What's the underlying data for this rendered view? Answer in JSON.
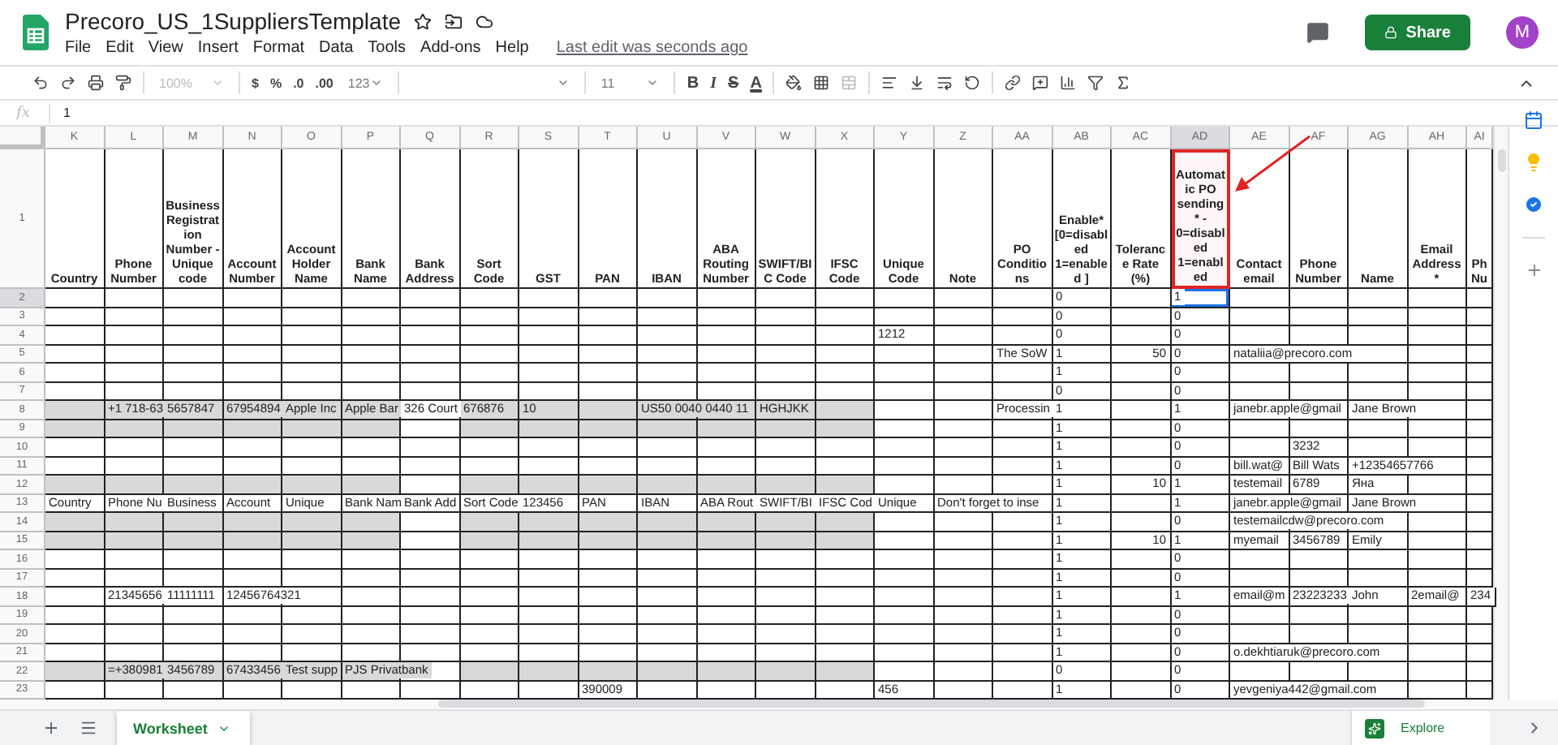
{
  "document": {
    "title": "Precoro_US_1SuppliersTemplate",
    "menu": [
      "File",
      "Edit",
      "View",
      "Insert",
      "Format",
      "Data",
      "Tools",
      "Add-ons",
      "Help"
    ],
    "last_edit": "Last edit was seconds ago"
  },
  "account": {
    "share_label": "Share",
    "avatar_initial": "M"
  },
  "toolbar": {
    "zoom": "100%",
    "currency": "$",
    "percent": "%",
    "decimal_less": ".0",
    "decimal_more": ".00",
    "number_format": "123",
    "font_size": "11",
    "bold": "B",
    "italic": "I",
    "strike": "S",
    "text_color": "A"
  },
  "formula_bar": {
    "fx_label": "fx",
    "value": "1"
  },
  "columns": [
    {
      "letter": "K",
      "shade_band": true,
      "selected": false,
      "highlighted": false,
      "numeric": false
    },
    {
      "letter": "L",
      "shade_band": true,
      "selected": false,
      "highlighted": false,
      "numeric": false
    },
    {
      "letter": "M",
      "shade_band": true,
      "selected": false,
      "highlighted": false,
      "numeric": false
    },
    {
      "letter": "N",
      "shade_band": true,
      "selected": false,
      "highlighted": false,
      "numeric": false
    },
    {
      "letter": "O",
      "shade_band": true,
      "selected": false,
      "highlighted": false,
      "numeric": false
    },
    {
      "letter": "P",
      "shade_band": true,
      "selected": false,
      "highlighted": false,
      "numeric": false
    },
    {
      "letter": "Q",
      "shade_band": false,
      "selected": false,
      "highlighted": false,
      "numeric": false
    },
    {
      "letter": "R",
      "shade_band": true,
      "selected": false,
      "highlighted": false,
      "numeric": false
    },
    {
      "letter": "S",
      "shade_band": true,
      "selected": false,
      "highlighted": false,
      "numeric": false
    },
    {
      "letter": "T",
      "shade_band": true,
      "selected": false,
      "highlighted": false,
      "numeric": false
    },
    {
      "letter": "U",
      "shade_band": true,
      "selected": false,
      "highlighted": false,
      "numeric": false
    },
    {
      "letter": "V",
      "shade_band": true,
      "selected": false,
      "highlighted": false,
      "numeric": false
    },
    {
      "letter": "W",
      "shade_band": true,
      "selected": false,
      "highlighted": false,
      "numeric": false
    },
    {
      "letter": "X",
      "shade_band": true,
      "selected": false,
      "highlighted": false,
      "numeric": false
    },
    {
      "letter": "Y",
      "shade_band": false,
      "selected": false,
      "highlighted": false,
      "numeric": false
    },
    {
      "letter": "Z",
      "shade_band": false,
      "selected": false,
      "highlighted": false,
      "numeric": false
    },
    {
      "letter": "AA",
      "shade_band": false,
      "selected": false,
      "highlighted": false,
      "numeric": false
    },
    {
      "letter": "AB",
      "shade_band": false,
      "selected": false,
      "highlighted": false,
      "numeric": false
    },
    {
      "letter": "AC",
      "shade_band": false,
      "selected": false,
      "highlighted": false,
      "numeric": true
    },
    {
      "letter": "AD",
      "shade_band": false,
      "selected": true,
      "highlighted": true,
      "numeric": false
    },
    {
      "letter": "AE",
      "shade_band": false,
      "selected": false,
      "highlighted": false,
      "numeric": false
    },
    {
      "letter": "AF",
      "shade_band": false,
      "selected": false,
      "highlighted": false,
      "numeric": false
    },
    {
      "letter": "AG",
      "shade_band": false,
      "selected": false,
      "highlighted": false,
      "numeric": false
    },
    {
      "letter": "AH",
      "shade_band": false,
      "selected": false,
      "highlighted": false,
      "numeric": false
    },
    {
      "letter": "AI",
      "shade_band": false,
      "selected": false,
      "highlighted": false,
      "numeric": false
    }
  ],
  "header_row": {
    "number": "1",
    "cells": [
      "Country",
      "Phone Number",
      "Business Registration Number - Unique code",
      "Account Number",
      "Account Holder Name",
      "Bank Name",
      "Bank Address",
      "Sort Code",
      "GST",
      "PAN",
      "IBAN",
      "ABA Routing Number",
      "SWIFT/BIC Code",
      "IFSC Code",
      "Unique Code",
      "Note",
      "PO Conditions",
      "Enable* [0=disabled 1=enabled ]",
      "Tolerance Rate (%)",
      "Automatic PO sending* - 0=disabled 1=enabled",
      "Contact email",
      "Phone Number",
      "Name",
      "Email Address *",
      "Ph Nu"
    ]
  },
  "rows": [
    {
      "number": "2",
      "shaded": false,
      "selected": true,
      "cells": [
        null,
        null,
        null,
        null,
        null,
        null,
        null,
        null,
        null,
        null,
        null,
        null,
        null,
        null,
        null,
        null,
        null,
        "0",
        null,
        "1",
        null,
        null,
        null,
        null,
        null
      ]
    },
    {
      "number": "3",
      "shaded": false,
      "selected": false,
      "cells": [
        null,
        null,
        null,
        null,
        null,
        null,
        null,
        null,
        null,
        null,
        null,
        null,
        null,
        null,
        null,
        null,
        null,
        "0",
        null,
        "0",
        null,
        null,
        null,
        null,
        null
      ]
    },
    {
      "number": "4",
      "shaded": false,
      "selected": false,
      "cells": [
        null,
        null,
        null,
        null,
        null,
        null,
        null,
        null,
        null,
        null,
        null,
        null,
        null,
        null,
        "1212",
        null,
        null,
        "0",
        null,
        "0",
        null,
        null,
        null,
        null,
        null
      ]
    },
    {
      "number": "5",
      "shaded": false,
      "selected": false,
      "cells": [
        null,
        null,
        null,
        null,
        null,
        null,
        null,
        null,
        null,
        null,
        null,
        null,
        null,
        null,
        null,
        null,
        "The SoW",
        "1",
        "50",
        "0",
        "nataliia@precoro.com",
        null,
        null,
        null,
        null
      ]
    },
    {
      "number": "6",
      "shaded": false,
      "selected": false,
      "cells": [
        null,
        null,
        null,
        null,
        null,
        null,
        null,
        null,
        null,
        null,
        null,
        null,
        null,
        null,
        null,
        null,
        null,
        "1",
        null,
        "0",
        null,
        null,
        null,
        null,
        null
      ]
    },
    {
      "number": "7",
      "shaded": false,
      "selected": false,
      "cells": [
        null,
        null,
        null,
        null,
        null,
        null,
        null,
        null,
        null,
        null,
        null,
        null,
        null,
        null,
        null,
        null,
        null,
        "0",
        null,
        "0",
        null,
        null,
        null,
        null,
        null
      ]
    },
    {
      "number": "8",
      "shaded": true,
      "selected": false,
      "cells": [
        null,
        "+1 718-63",
        "5657847",
        "67954894",
        "Apple Inc",
        "Apple Bar",
        "326 Court",
        "676876",
        "10",
        null,
        "US50 0040 0440 11",
        null,
        "HGHJKK",
        null,
        null,
        null,
        "Processin",
        "1",
        null,
        "1",
        "janebr.apple@gmail",
        null,
        "Jane Brown",
        null,
        null
      ]
    },
    {
      "number": "9",
      "shaded": true,
      "selected": false,
      "cells": [
        null,
        null,
        null,
        null,
        null,
        null,
        null,
        null,
        null,
        null,
        null,
        null,
        null,
        null,
        null,
        null,
        null,
        "1",
        null,
        "0",
        null,
        null,
        null,
        null,
        null
      ]
    },
    {
      "number": "10",
      "shaded": false,
      "selected": false,
      "cells": [
        null,
        null,
        null,
        null,
        null,
        null,
        null,
        null,
        null,
        null,
        null,
        null,
        null,
        null,
        null,
        null,
        null,
        "1",
        null,
        "0",
        null,
        "3232",
        null,
        null,
        null
      ]
    },
    {
      "number": "11",
      "shaded": false,
      "selected": false,
      "cells": [
        null,
        null,
        null,
        null,
        null,
        null,
        null,
        null,
        null,
        null,
        null,
        null,
        null,
        null,
        null,
        null,
        null,
        "1",
        null,
        "0",
        "bill.wat@",
        "Bill Wats",
        "+12354657766",
        null,
        null
      ]
    },
    {
      "number": "12",
      "shaded": true,
      "selected": false,
      "cells": [
        null,
        null,
        null,
        null,
        null,
        null,
        null,
        null,
        null,
        null,
        null,
        null,
        null,
        null,
        null,
        null,
        null,
        "1",
        "10",
        "1",
        "testemail",
        "6789",
        "Яна",
        null,
        null
      ]
    },
    {
      "number": "13",
      "shaded": false,
      "selected": false,
      "cells": [
        "Country",
        "Phone Nu",
        "Business",
        "Account",
        "Unique",
        "Bank Nam",
        "Bank Add",
        "Sort Code",
        "123456",
        "PAN",
        "IBAN",
        "ABA Rout",
        "SWIFT/BI",
        "IFSC Cod",
        "Unique",
        "Don't forget to inse",
        null,
        "1",
        null,
        "1",
        "janebr.apple@gmail",
        null,
        "Jane Brown",
        null,
        null
      ]
    },
    {
      "number": "14",
      "shaded": true,
      "selected": false,
      "cells": [
        null,
        null,
        null,
        null,
        null,
        null,
        null,
        null,
        null,
        null,
        null,
        null,
        null,
        null,
        null,
        null,
        null,
        "1",
        null,
        "0",
        "testemailcdw@precoro.com",
        null,
        null,
        null,
        null
      ]
    },
    {
      "number": "15",
      "shaded": true,
      "selected": false,
      "cells": [
        null,
        null,
        null,
        null,
        null,
        null,
        null,
        null,
        null,
        null,
        null,
        null,
        null,
        null,
        null,
        null,
        null,
        "1",
        "10",
        "1",
        "myemail",
        "3456789",
        "Emily",
        null,
        null
      ]
    },
    {
      "number": "16",
      "shaded": false,
      "selected": false,
      "cells": [
        null,
        null,
        null,
        null,
        null,
        null,
        null,
        null,
        null,
        null,
        null,
        null,
        null,
        null,
        null,
        null,
        null,
        "1",
        null,
        "0",
        null,
        null,
        null,
        null,
        null
      ]
    },
    {
      "number": "17",
      "shaded": false,
      "selected": false,
      "cells": [
        null,
        null,
        null,
        null,
        null,
        null,
        null,
        null,
        null,
        null,
        null,
        null,
        null,
        null,
        null,
        null,
        null,
        "1",
        null,
        "0",
        null,
        null,
        null,
        null,
        null
      ]
    },
    {
      "number": "18",
      "shaded": false,
      "selected": false,
      "cells": [
        null,
        "21345656",
        "11111111",
        "12456764321",
        null,
        null,
        null,
        null,
        null,
        null,
        null,
        null,
        null,
        null,
        null,
        null,
        null,
        "1",
        null,
        "1",
        "email@m",
        "23223233",
        "John",
        "2email@",
        "234"
      ]
    },
    {
      "number": "19",
      "shaded": false,
      "selected": false,
      "cells": [
        null,
        null,
        null,
        null,
        null,
        null,
        null,
        null,
        null,
        null,
        null,
        null,
        null,
        null,
        null,
        null,
        null,
        "1",
        null,
        "0",
        null,
        null,
        null,
        null,
        null
      ]
    },
    {
      "number": "20",
      "shaded": false,
      "selected": false,
      "cells": [
        null,
        null,
        null,
        null,
        null,
        null,
        null,
        null,
        null,
        null,
        null,
        null,
        null,
        null,
        null,
        null,
        null,
        "1",
        null,
        "0",
        null,
        null,
        null,
        null,
        null
      ]
    },
    {
      "number": "21",
      "shaded": false,
      "selected": false,
      "cells": [
        null,
        null,
        null,
        null,
        null,
        null,
        null,
        null,
        null,
        null,
        null,
        null,
        null,
        null,
        null,
        null,
        null,
        "1",
        null,
        "0",
        "o.dekhtiaruk@precoro.com",
        null,
        null,
        null,
        null
      ]
    },
    {
      "number": "22",
      "shaded": true,
      "selected": false,
      "cells": [
        null,
        "=+380981",
        "3456789",
        "67433456",
        "Test supp",
        "PJS Privatbank",
        null,
        null,
        null,
        null,
        null,
        null,
        null,
        null,
        null,
        null,
        null,
        "0",
        null,
        "0",
        null,
        null,
        null,
        null,
        null
      ]
    },
    {
      "number": "23",
      "shaded": false,
      "selected": false,
      "cells": [
        null,
        null,
        null,
        null,
        null,
        null,
        null,
        null,
        null,
        "390009",
        null,
        null,
        null,
        null,
        "456",
        null,
        null,
        "1",
        null,
        "0",
        "yevgeniya442@gmail.com",
        null,
        null,
        null,
        null
      ]
    }
  ],
  "sheet_tabs": [
    {
      "label": "Worksheet",
      "selected": true
    }
  ],
  "explore_label": "Explore"
}
